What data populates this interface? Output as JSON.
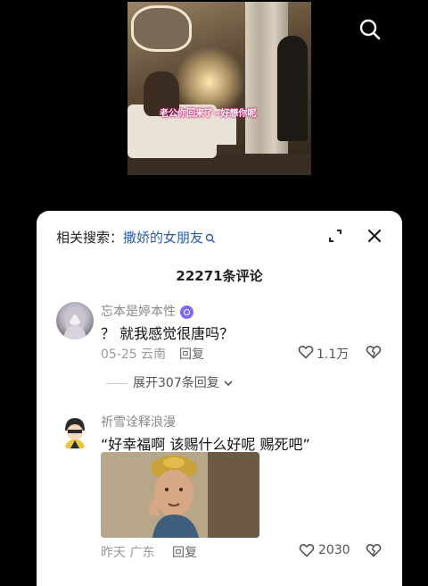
{
  "video": {
    "caption": "老公你回来了~好想你呢"
  },
  "top_bar": {
    "search_icon": "search-icon"
  },
  "panel": {
    "related_label": "相关搜索：",
    "related_keyword": "撒娇的女朋友",
    "comment_count": "22271条评论",
    "icons": {
      "expand": "fullscreen-expand-icon",
      "close": "close-icon"
    }
  },
  "comments": [
    {
      "username": "忘本是婷本性",
      "text": "？ 就我感觉很唐吗？",
      "date": "05-25",
      "location": "云南",
      "reply_label": "回复",
      "likes": "1.1万",
      "expand_replies": "展开307条回复"
    },
    {
      "username": "祈雪诠释浪漫",
      "text": "“好幸福啊 该赐什么好呢 赐死吧”",
      "date": "昨天",
      "location": "广东",
      "reply_label": "回复",
      "likes": "2030"
    }
  ],
  "colors": {
    "keyword": "#2b5ca8",
    "badge": "#7d6bf0",
    "sheet_bg": "#ffffff",
    "page_bg": "#000000"
  }
}
